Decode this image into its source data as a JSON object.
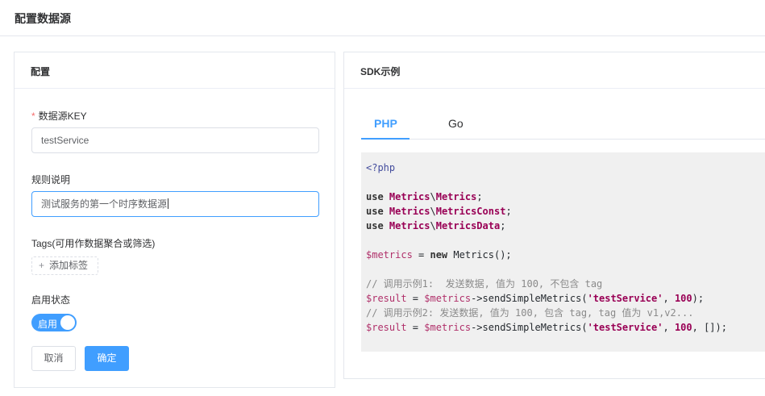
{
  "page": {
    "title": "配置数据源"
  },
  "config_card": {
    "title": "配置",
    "key_field": {
      "required_mark": "*",
      "label": "数据源KEY",
      "value": "testService"
    },
    "desc_field": {
      "label": "规则说明",
      "value": "测试服务的第一个时序数据源"
    },
    "tags_field": {
      "label": "Tags(可用作数据聚合或筛选)",
      "add_label": "添加标签",
      "add_icon": "+"
    },
    "status_field": {
      "label": "启用状态",
      "switch_text": "启用",
      "enabled": true
    },
    "cancel_label": "取消",
    "confirm_label": "确定"
  },
  "sdk_card": {
    "title": "SDK示例",
    "tabs": [
      {
        "label": "PHP",
        "active": true
      },
      {
        "label": "Go",
        "active": false
      }
    ],
    "code": {
      "open_tag": "<?php",
      "use_kw": "use",
      "ns": "Metrics",
      "sep": "\\",
      "uses": [
        "Metrics",
        "MetricsConst",
        "MetricsData"
      ],
      "var_metrics": "$metrics",
      "new_kw": "new",
      "ctor": "Metrics();",
      "comment1": "// 调用示例1:  发送数据, 值为 100, 不包含 tag",
      "var_result": "$result",
      "call": "sendSimpleMetrics(",
      "arg_str": "'testService'",
      "arg_num": "100",
      "comment2": "// 调用示例2: 发送数据, 值为 100, 包含 tag, tag 值为 v1,v2...",
      "arg_arr": "[]"
    }
  },
  "colors": {
    "accent": "#409eff",
    "required": "#f56c6c"
  }
}
